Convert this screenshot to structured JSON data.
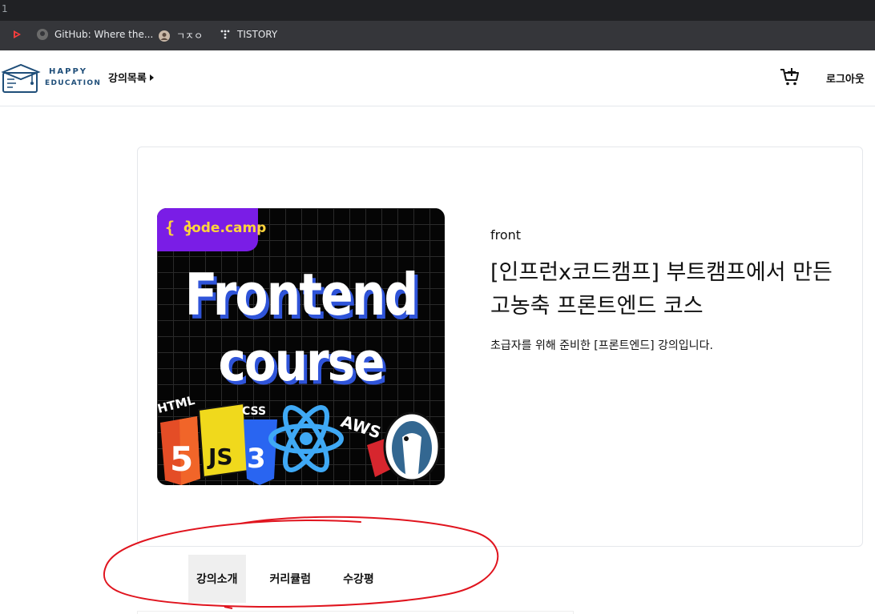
{
  "browser": {
    "tab_index": "1",
    "bookmarks": [
      {
        "label": "",
        "icon": "red-play-icon"
      },
      {
        "label": "GitHub: Where the...",
        "icon": "github-icon"
      },
      {
        "label": "ㄱㅈㅇ",
        "icon": "avatar-icon"
      },
      {
        "label": "TISTORY",
        "icon": "tistory-icon"
      }
    ]
  },
  "header": {
    "logo_top": "HAPPY",
    "logo_bottom": "EDUCATION",
    "nav_course": "강의목록",
    "logout": "로그아웃"
  },
  "course": {
    "thumbnail": {
      "brand_brace": "{ }",
      "brand": "code.camp",
      "line1": "Frontend",
      "line2": "course",
      "logo_labels": [
        "HTML",
        "5",
        "JS",
        "CSS",
        "AWS"
      ]
    },
    "category": "front",
    "title": "[인프런x코드캠프] 부트캠프에서 만든 고농축 프론트엔드 코스",
    "description": "초급자를 위해 준비한 [프론트엔드] 강의입니다."
  },
  "tabs": [
    {
      "label": "강의소개",
      "active": true
    },
    {
      "label": "커리큘럼",
      "active": false
    },
    {
      "label": "수강평",
      "active": false
    }
  ],
  "colors": {
    "accent_purple": "#7a1de6",
    "brand_yellow": "#ffd43b",
    "logo_blue": "#1f4e79",
    "annotation_red": "#e0141e"
  }
}
